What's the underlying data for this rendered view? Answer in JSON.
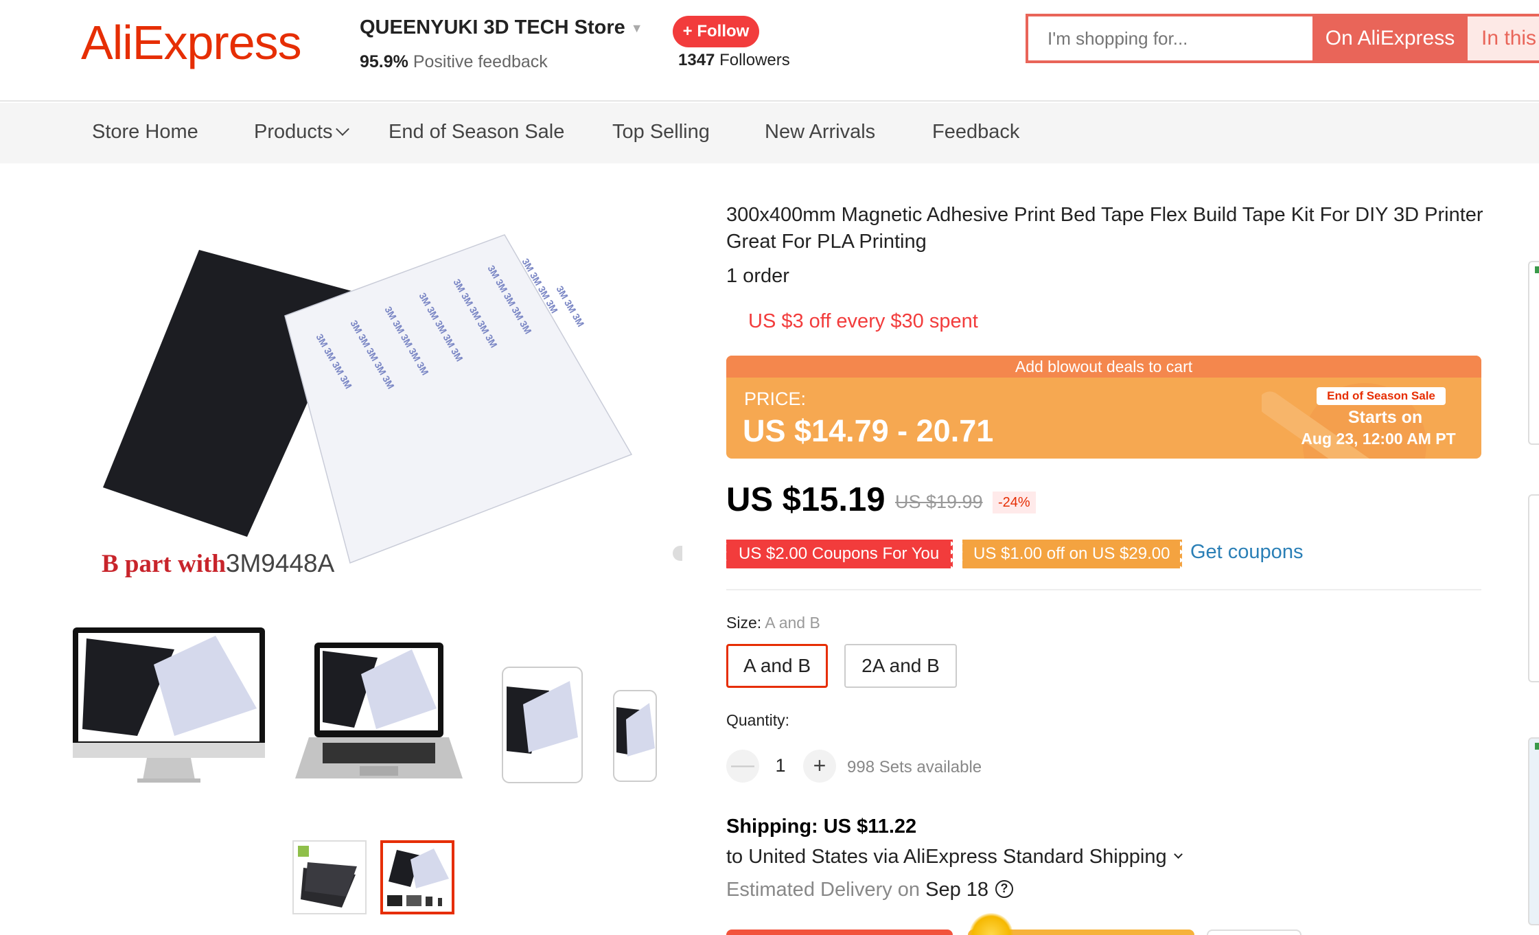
{
  "header": {
    "logo_text": "AliExpress",
    "store_name": "QUEENYUKI 3D TECH Store",
    "feedback_percent": "95.9%",
    "feedback_label": "Positive feedback",
    "follow_label": "+ Follow",
    "followers_count": "1347",
    "followers_label": "Followers",
    "search_placeholder": "I'm shopping for...",
    "search_on_aliexpress": "On AliExpress",
    "search_in_store": "In this store"
  },
  "nav": {
    "items": [
      {
        "label": "Store Home"
      },
      {
        "label": "Products"
      },
      {
        "label": "End of Season Sale"
      },
      {
        "label": "Top Selling"
      },
      {
        "label": "New Arrivals"
      },
      {
        "label": "Feedback"
      }
    ]
  },
  "gallery": {
    "caption_prefix": "B part with",
    "caption_suffix": "3M9448A",
    "selected_thumbnail_index": 1
  },
  "product": {
    "title": "300x400mm Magnetic Adhesive Print Bed Tape Flex Build Tape Kit For DIY 3D Printer Great For PLA Printing",
    "orders": "1 order",
    "promo_text": "US $3 off every $30 spent",
    "deal": {
      "top_label": "Add blowout deals to cart",
      "price_label": "PRICE:",
      "price_range": "US $14.79 - 20.71",
      "badge": "End of Season Sale",
      "starts_label": "Starts on",
      "start_date": "Aug 23, 12:00 AM PT"
    },
    "current_price": "US $15.19",
    "original_price": "US $19.99",
    "discount": "-24%",
    "coupons": [
      {
        "label": "US $2.00 Coupons For You"
      },
      {
        "label": "US $1.00 off on US $29.00"
      }
    ],
    "get_coupons_label": "Get coupons",
    "size": {
      "label": "Size:",
      "selected_value": "A and B",
      "options": [
        {
          "label": "A and B",
          "selected": true
        },
        {
          "label": "2A and B",
          "selected": false
        }
      ]
    },
    "quantity": {
      "label": "Quantity:",
      "minus": "—",
      "plus": "+",
      "value": "1",
      "available": "998 Sets available"
    },
    "shipping": {
      "cost": "Shipping: US $11.22",
      "destination": "to United States via AliExpress Standard Shipping",
      "delivery_label": "Estimated Delivery on",
      "delivery_date": "Sep 18",
      "help_icon": "?"
    }
  },
  "colors": {
    "brand_red": "#e62e04",
    "follow_red": "#f23c3c",
    "search_red": "#e96559",
    "deal_orange": "#f6a851",
    "coupon_orange": "#f4a340",
    "link_blue": "#2a7fb6"
  },
  "icons": {
    "store_dropdown": "caret-down-icon",
    "products_dropdown": "chevron-down-icon",
    "shipping_dropdown": "chevron-down-icon",
    "help": "question-circle-icon",
    "minus": "minus-icon",
    "plus": "plus-icon"
  }
}
